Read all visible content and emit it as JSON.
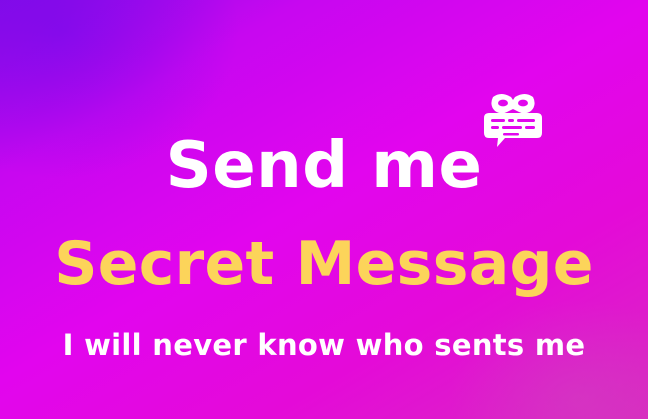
{
  "headline": {
    "line1": "Send me",
    "line2": "Secret Message",
    "line3": "I will never know who sents me"
  },
  "icon": {
    "name": "secret-message-mask-chat-icon"
  },
  "colors": {
    "background_start": "#8a0be8",
    "background_mid": "#e205ee",
    "background_end": "#d92bc0",
    "primary_text": "#ffffff",
    "accent_text": "#fcd45a"
  }
}
